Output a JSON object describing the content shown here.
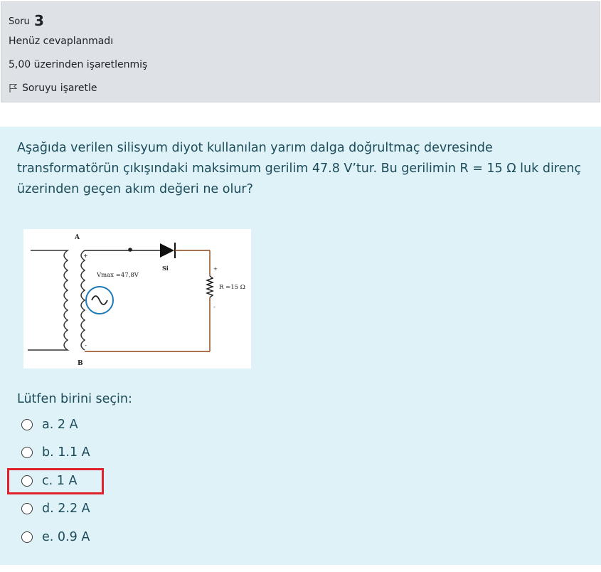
{
  "info": {
    "question_label": "Soru",
    "question_number": "3",
    "state": "Henüz cevaplanmadı",
    "grade": "5,00 üzerinden işaretlenmiş",
    "flag_label": "Soruyu işaretle"
  },
  "question": {
    "text": "Aşağıda verilen silisyum diyot kullanılan yarım dalga doğrultmaç devresinde transformatörün çıkışındaki maksimum gerilim 47.8 V’tur. Bu gerilimin R = 15 Ω luk direnç üzerinden geçen akım değeri ne olur?",
    "figure": {
      "label_a": "A",
      "label_b": "B",
      "label_plus_top": "+",
      "label_minus_bottom": "-",
      "vmax": "Vmax =47,8V",
      "diode": "Si",
      "resistor": "R =15 Ω",
      "label_plus_r": "+",
      "label_minus_r": "-"
    },
    "prompt": "Lütfen birini seçin:",
    "options": [
      {
        "letter": "a.",
        "text": "2 A"
      },
      {
        "letter": "b.",
        "text": "1.1 A"
      },
      {
        "letter": "c.",
        "text": "1 A"
      },
      {
        "letter": "d.",
        "text": "2.2 A"
      },
      {
        "letter": "e.",
        "text": "0.9 A"
      }
    ]
  },
  "colors": {
    "info_bg": "#dee2e6",
    "content_bg": "#def2f8",
    "text": "#1c4b5a",
    "highlight": "#e0202a",
    "wire": "#a0522d",
    "source_circle": "#1e7ab8"
  }
}
